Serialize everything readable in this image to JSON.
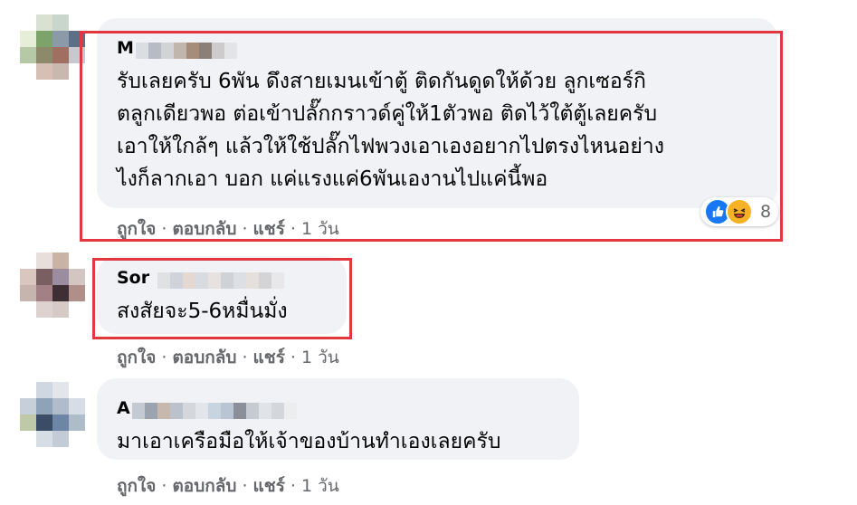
{
  "comments": [
    {
      "author_visible": "M",
      "lines": [
        "รับเลยครับ 6พัน ดึงสายเมนเข้าตู้ ติดกันดูดให้ด้วย ลูกเซอร์กิ",
        "ตลูกเดียวพอ ต่อเข้าปลั๊กกราวด์คู่ให้1ตัวพอ ติดไว้ใต้ตู้เลยครับ",
        "เอาให้ใกล้ๆ แล้วให้ใช้ปลั๊กไฟพวงเอาเองอยากไปตรงไหนอย่าง",
        "ไงก็ลากเอา บอก แค่แรงแค่6พันเองานไปแค่นี้พอ"
      ],
      "reactions": {
        "icons": [
          "like-icon",
          "haha-icon"
        ],
        "count": "8"
      },
      "actions": {
        "like": "ถูกใจ",
        "reply": "ตอบกลับ",
        "share": "แชร์",
        "time": "1 วัน"
      }
    },
    {
      "author_visible": "Sor",
      "lines": [
        "สงสัยจะ5-6หมื่นมั่ง"
      ],
      "actions": {
        "like": "ถูกใจ",
        "reply": "ตอบกลับ",
        "share": "แชร์",
        "time": "1 วัน"
      }
    },
    {
      "author_visible": "A",
      "lines": [
        "มาเอาเครือมือให้เจ้าของบ้านทำเองเลยครับ"
      ],
      "actions": {
        "like": "ถูกใจ",
        "reply": "ตอบกลับ",
        "share": "แชร์",
        "time": "1 วัน"
      }
    }
  ],
  "colors": {
    "bubble": "#f0f2f5",
    "highlight": "#e2373e",
    "meta": "#65676b",
    "like": "#1877f2",
    "haha": "#f7b125"
  }
}
